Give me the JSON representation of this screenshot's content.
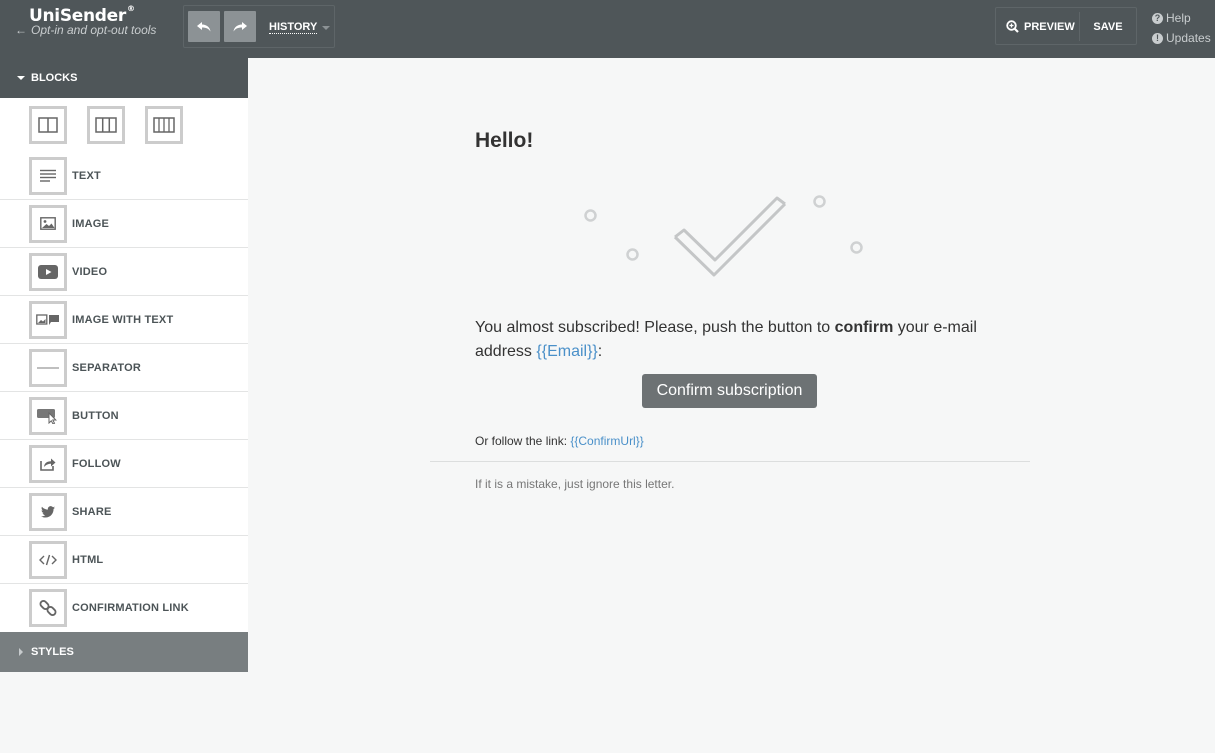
{
  "header": {
    "brand": "UniSender",
    "brand_mark": "®",
    "back_label": "Opt-in and opt-out tools",
    "history_label": "HISTORY",
    "preview_label": "PREVIEW",
    "save_label": "SAVE",
    "help_label": "Help",
    "updates_label": "Updates"
  },
  "sidebar": {
    "blocks_label": "BLOCKS",
    "styles_label": "STYLES",
    "layouts": [
      "two-columns-icon",
      "three-columns-icon",
      "four-columns-icon"
    ],
    "items": [
      {
        "label": "TEXT",
        "icon": "text-lines-icon"
      },
      {
        "label": "IMAGE",
        "icon": "image-icon"
      },
      {
        "label": "VIDEO",
        "icon": "video-play-icon"
      },
      {
        "label": "IMAGE WITH TEXT",
        "icon": "image-with-text-icon"
      },
      {
        "label": "SEPARATOR",
        "icon": "separator-line-icon"
      },
      {
        "label": "BUTTON",
        "icon": "button-cursor-icon"
      },
      {
        "label": "FOLLOW",
        "icon": "share-out-icon"
      },
      {
        "label": "SHARE",
        "icon": "twitter-bird-icon"
      },
      {
        "label": "HTML",
        "icon": "code-brackets-icon"
      },
      {
        "label": "CONFIRMATION LINK",
        "icon": "chain-link-icon"
      }
    ]
  },
  "email": {
    "title": "Hello!",
    "body_part1": "You almost subscribed! Please, push the button to ",
    "body_bold": "confirm",
    "body_part2": " your e-mail address ",
    "email_var": "{{Email}}",
    "body_colon": ":",
    "button_label": "Confirm subscription",
    "follow_text": "Or follow the link: ",
    "confirm_url_var": "{{ConfirmUrl}}",
    "mistake_text": "If it is a mistake, just ignore this letter."
  },
  "colors": {
    "topbar": "#4f5659",
    "link": "#4a90c9",
    "button": "#6d7274",
    "styles_bar": "#787e80"
  }
}
